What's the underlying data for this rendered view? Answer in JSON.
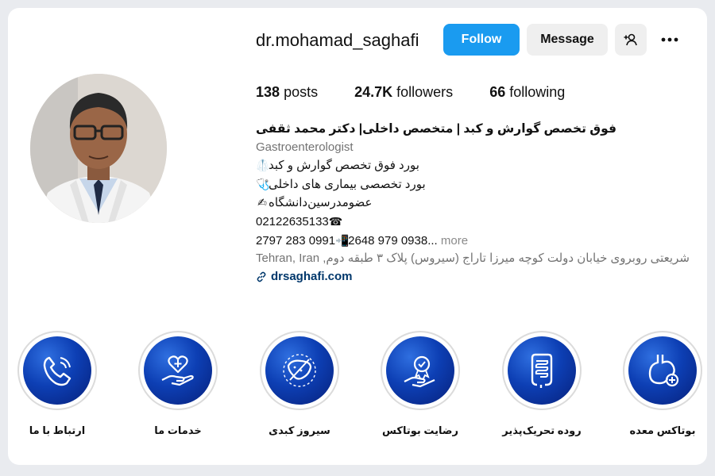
{
  "profile": {
    "username": "dr.mohamad_saghafi",
    "avatar_icon": "doctor-portrait"
  },
  "actions": {
    "follow_label": "Follow",
    "message_label": "Message",
    "add_icon": "add-person-icon",
    "more_icon": "more-options-icon"
  },
  "stats": {
    "posts_count": "138",
    "posts_label": "posts",
    "followers_count": "24.7K",
    "followers_label": "followers",
    "following_count": "66",
    "following_label": "following"
  },
  "bio": {
    "name_line": "فوق تخصص گوارش و کبد | متخصص داخلی| دکتر محمد ثقفی",
    "category": "Gastroenterologist",
    "line1": "بورد فوق تخصص گوارش و کبد",
    "line2": "بورد تخصصی بیماری های داخلی",
    "line3": "عضومدرسین‌دانشگاه",
    "phone1": "02122635133",
    "phone2": "2797 283 0991",
    "phone3": "2648 979 0938...",
    "more_label": "more",
    "address_city": "Tehran, Iran",
    "address_text": "شریعتی روبروی خیابان دولت کوچه میرزا تاراج (سیروس) پلاک ۳ طبقه دوم,",
    "website": "drsaghafi.com"
  },
  "highlights": [
    {
      "label": "ارتباط با ما",
      "icon": "phone-icon"
    },
    {
      "label": "خدمات ما",
      "icon": "heart-hand-icon"
    },
    {
      "label": "سیروز کبدی",
      "icon": "liver-icon"
    },
    {
      "label": "رضایت بوتاکس",
      "icon": "award-hand-icon"
    },
    {
      "label": "روده تحریک‌پذیر",
      "icon": "intestine-icon"
    },
    {
      "label": "بوتاکس معده",
      "icon": "stomach-icon"
    }
  ],
  "colors": {
    "follow_blue": "#1a9bf0",
    "link_blue": "#00376b",
    "highlight_blue": "#0d3fb4",
    "muted_gray": "#737373"
  }
}
